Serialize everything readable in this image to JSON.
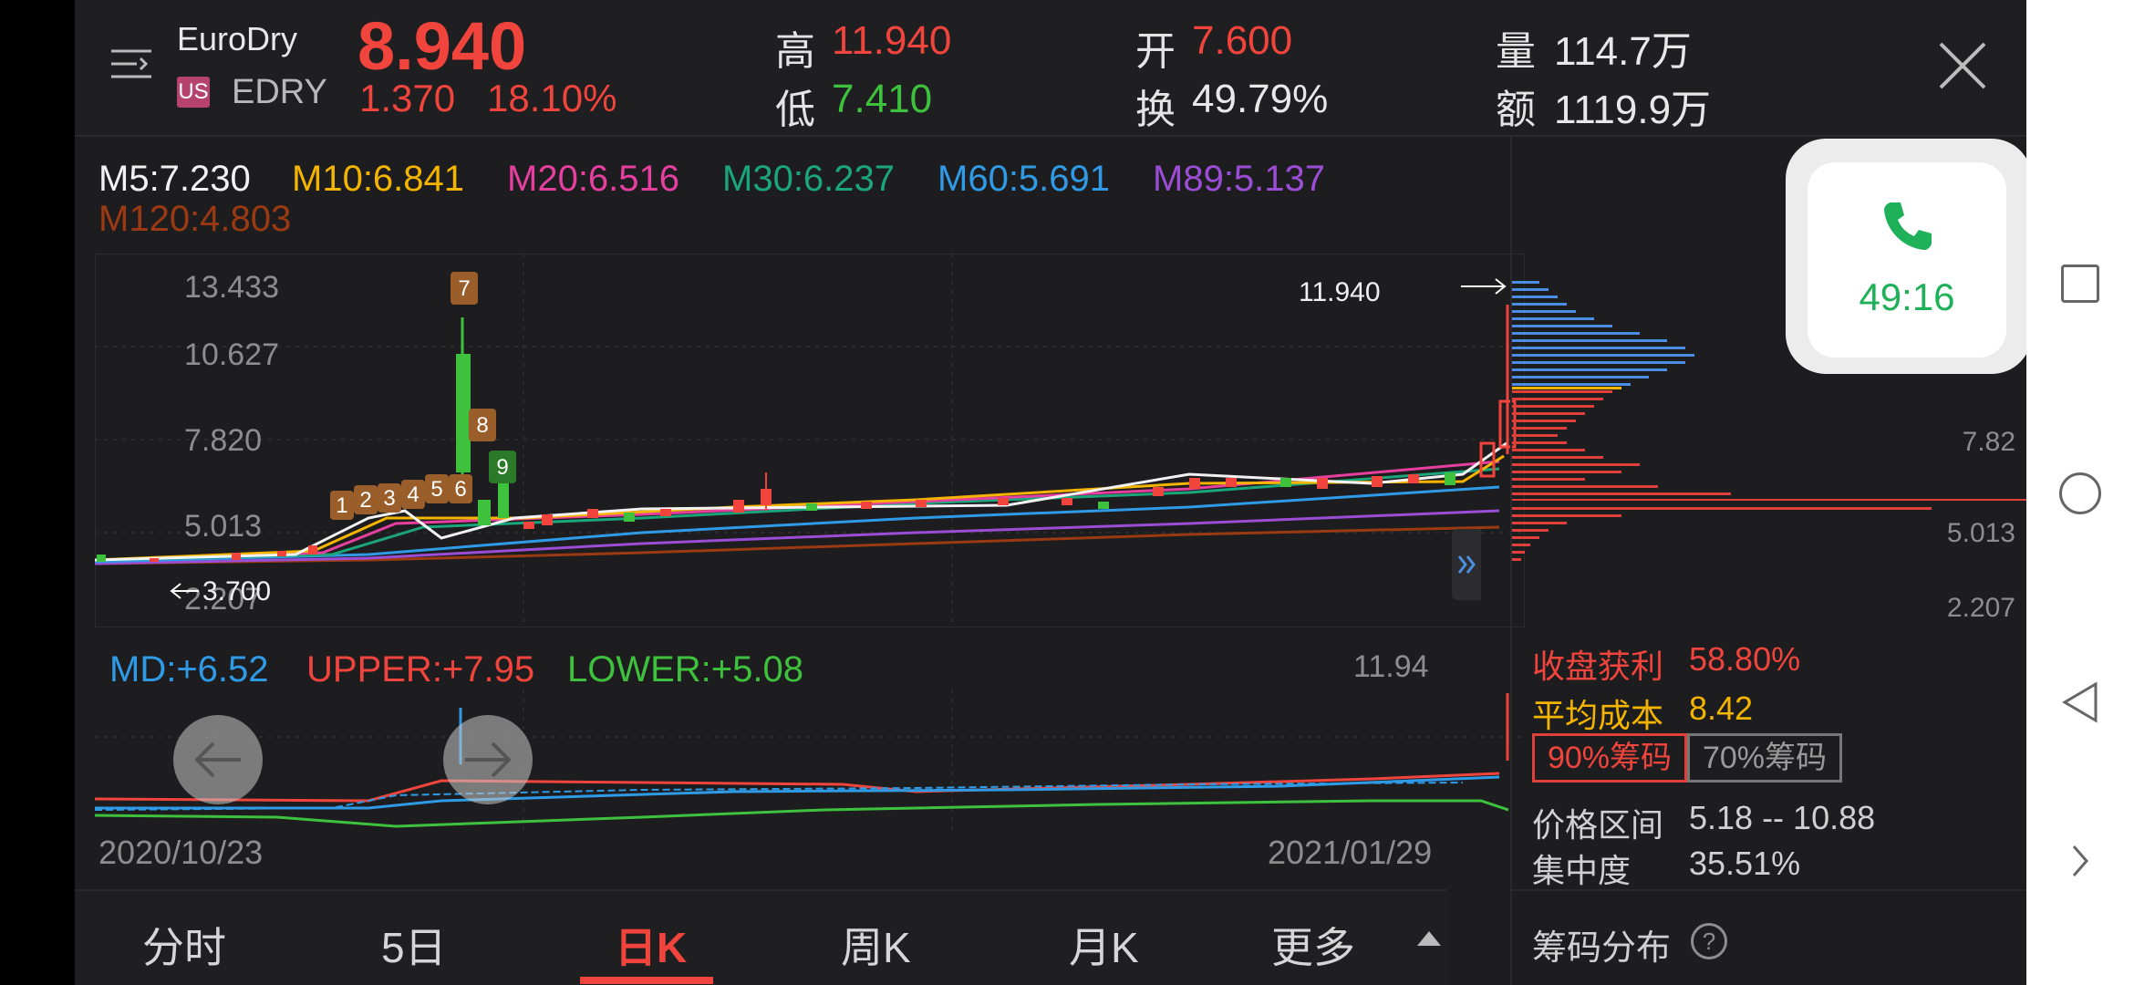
{
  "stock": {
    "name": "EuroDry",
    "market_badge": "US",
    "ticker": "EDRY",
    "price": "8.940",
    "change": "1.370",
    "change_pct": "18.10%"
  },
  "stats": {
    "high_label": "高",
    "high": "11.940",
    "low_label": "低",
    "low": "7.410",
    "open_label": "开",
    "open": "7.600",
    "turnover_label": "换",
    "turnover": "49.79%",
    "volume_label": "量",
    "volume": "114.7万",
    "amount_label": "额",
    "amount": "1119.9万"
  },
  "ma_legend": [
    {
      "text": "M5:7.230",
      "color": "#f2f2f2"
    },
    {
      "text": "M10:6.841",
      "color": "#f4b400"
    },
    {
      "text": "M20:6.516",
      "color": "#e63fa0"
    },
    {
      "text": "M30:6.237",
      "color": "#1aa67a"
    },
    {
      "text": "M60:5.691",
      "color": "#2f9be6"
    },
    {
      "text": "M89:5.137",
      "color": "#9b4dd6"
    },
    {
      "text": "M120:4.803",
      "color": "#9b3a12"
    }
  ],
  "kline": {
    "y_ticks": [
      "13.433",
      "10.627",
      "7.820",
      "5.013",
      "2.207"
    ],
    "high_marker": "11.940",
    "low_marker": "3.700",
    "event_markers": [
      "1",
      "2",
      "3",
      "4",
      "5",
      "6",
      "7",
      "8",
      "9"
    ]
  },
  "boll": {
    "md": "MD:+6.52",
    "upper": "UPPER:+7.95",
    "lower": "LOWER:+5.08",
    "max_label": "11.94"
  },
  "dates": {
    "start": "2020/10/23",
    "end": "2021/01/29"
  },
  "chip": {
    "y_ticks": [
      "7.82",
      "5.013",
      "2.207"
    ],
    "profit_label": "收盘获利",
    "profit": "58.80%",
    "avg_cost_label": "平均成本",
    "avg_cost": "8.42",
    "tab_90": "90%筹码",
    "tab_70": "70%筹码",
    "range_label": "价格区间",
    "range": "5.18 -- 10.88",
    "concentration_label": "集中度",
    "concentration": "35.51%",
    "footer": "筹码分布"
  },
  "call_widget": {
    "timer": "49:16"
  },
  "tabs": [
    "分时",
    "5日",
    "日K",
    "周K",
    "月K",
    "更多"
  ],
  "active_tab": "日K",
  "colors": {
    "up": "#f0443c",
    "down": "#3ec23e",
    "accent": "#f0443c",
    "bg": "#1d1d1f"
  }
}
